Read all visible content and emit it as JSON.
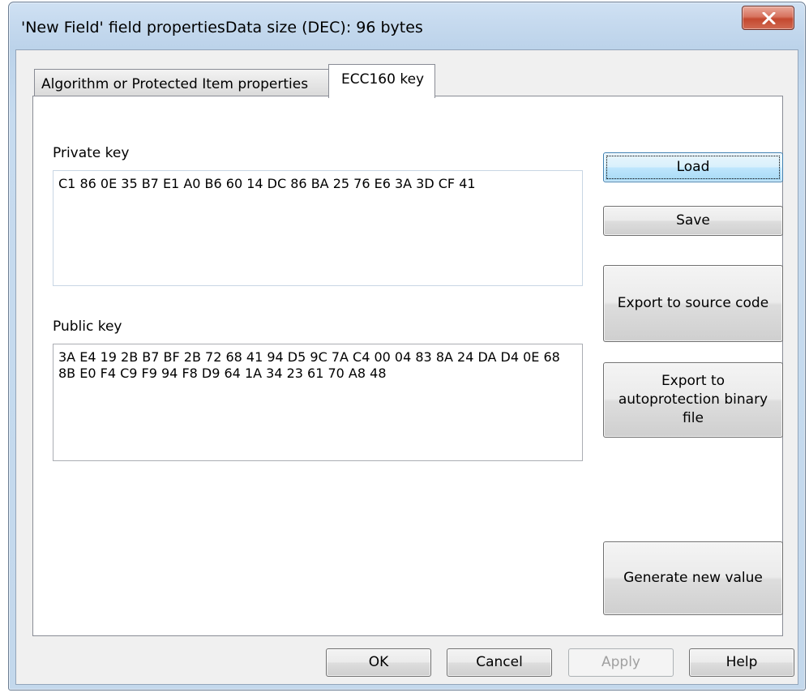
{
  "window": {
    "title": "'New Field' field propertiesData size (DEC): 96 bytes"
  },
  "tabs": [
    {
      "label": "Algorithm or Protected Item properties",
      "active": false
    },
    {
      "label": "ECC160 key",
      "active": true
    }
  ],
  "private_key": {
    "label": "Private key",
    "value": "C1 86 0E 35 B7 E1 A0 B6 60 14 DC 86 BA 25 76 E6 3A 3D CF 41"
  },
  "public_key": {
    "label": "Public key",
    "value": "3A E4 19 2B B7 BF 2B 72 68 41 94 D5 9C 7A C4 00 04 83 8A 24 DA D4 0E 68 8B E0 F4 C9 F9 94 F8 D9 64 1A 34 23 61 70 A8 48"
  },
  "side_buttons": {
    "load": "Load",
    "save": "Save",
    "export_source": "Export to source code",
    "export_binary": "Export to autoprotection binary file",
    "generate": "Generate new value"
  },
  "footer_buttons": {
    "ok": "OK",
    "cancel": "Cancel",
    "apply": "Apply",
    "help": "Help"
  },
  "colors": {
    "frame": "#c5d9ee",
    "close_button": "#c4482f",
    "default_button": "#bee6fd"
  },
  "icons": {
    "close": "close-icon"
  }
}
